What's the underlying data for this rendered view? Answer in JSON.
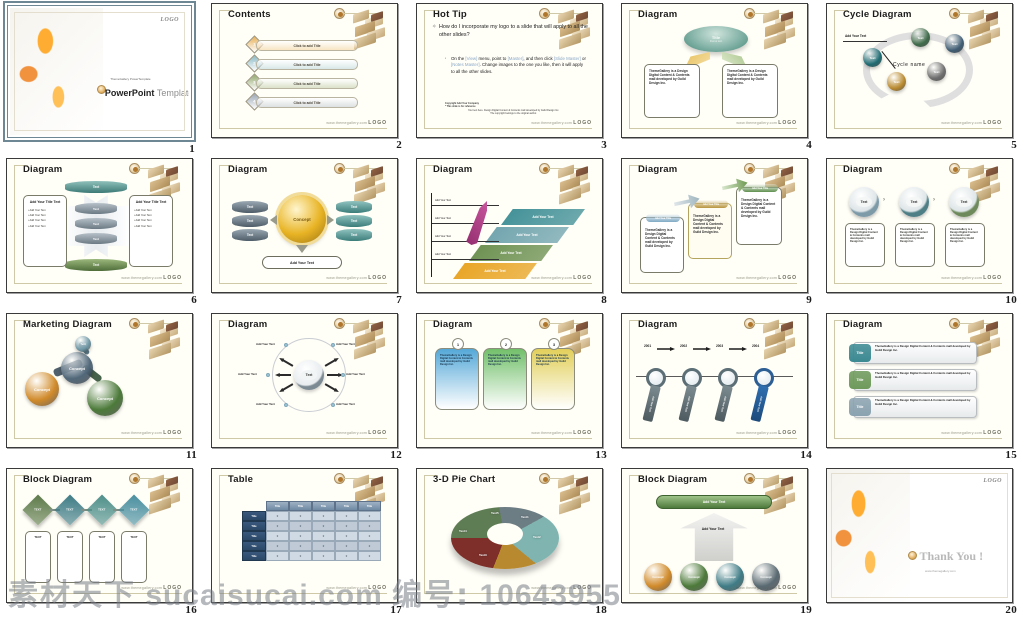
{
  "document": {
    "type": "powerpoint-template-preview-sheet",
    "slide_count": 20,
    "common": {
      "footer_url": "www.themegallery.com",
      "footer_brand": "LOGO",
      "logo_text": "LOGO",
      "theme_text": "ThemeGallery is a Design Digital Content & Contents mall developed by Guild Design Inc.",
      "add_your_text": "Add Your Text",
      "add_your_title_text": "Add Your Title Text",
      "text_label": "Text",
      "title_label": "Title",
      "concept_label": "Concept"
    }
  },
  "slides": [
    {
      "number": "1",
      "title": "",
      "kind": "cover",
      "logo": "LOGO",
      "subtitle": "ThemeGallery PowerTemplate",
      "main_bold": "PowerPoint",
      "main_light": "Template",
      "selected": true
    },
    {
      "number": "2",
      "title": "Contents",
      "kind": "contents",
      "items": [
        {
          "index": "1",
          "label": "Click to add Title",
          "color": "#e8b15a"
        },
        {
          "index": "2",
          "label": "Click to add Title",
          "color": "#8cb9c6"
        },
        {
          "index": "3",
          "label": "Click to add Title",
          "color": "#93a86d"
        },
        {
          "index": "4",
          "label": "Click to add Title",
          "color": "#9aa6b4"
        }
      ]
    },
    {
      "number": "3",
      "title": "Hot Tip",
      "kind": "hot-tip",
      "question": "How do I incorporate my logo to a slide that will apply to all the other slides?",
      "answer_parts": [
        {
          "text": "On the ",
          "highlight": false
        },
        {
          "text": "[View]",
          "highlight": true
        },
        {
          "text": " menu, point to ",
          "highlight": false
        },
        {
          "text": "[Master]",
          "highlight": true
        },
        {
          "text": ", and then click ",
          "highlight": false
        },
        {
          "text": "[Slide Master]",
          "highlight": true
        },
        {
          "text": " or ",
          "highlight": false
        },
        {
          "text": "[Notes Master]",
          "highlight": true
        },
        {
          "text": ". Change images to the one you like, then it will apply to all the other slides.",
          "highlight": false
        }
      ],
      "note_line1": "Copyright Add Your Company",
      "note_line2": "* This slide is for reference",
      "note_line3": "Your text here. Design Digital Content & Contents mall developed by Guild Design Inc.",
      "note_line4": "The copyright belongs to the original author."
    },
    {
      "number": "4",
      "title": "Diagram",
      "kind": "hub-two-box",
      "hub_title": "Title",
      "hub_sub": "theme text",
      "box_left": "ThemeGallery is a Design Digital Content & Contents mall developed by Guild Design Inc.",
      "box_right": "ThemeGallery is a Design Digital Content & Contents mall developed by Guild Design Inc."
    },
    {
      "number": "5",
      "title": "Cycle Diagram",
      "kind": "cycle",
      "callout": "Add Your Text",
      "center_label": "Cycle name",
      "nodes": [
        {
          "label": "Text",
          "color": "#3f6b4a"
        },
        {
          "label": "Text",
          "color": "#3f5d73"
        },
        {
          "label": "Text",
          "color": "#6d6d6d"
        },
        {
          "label": "Text",
          "color": "#b8892f"
        },
        {
          "label": "Text",
          "color": "#1e6b72"
        }
      ]
    },
    {
      "number": "6",
      "title": "Diagram",
      "kind": "stack-four",
      "top_label": "Text",
      "bottom_label": "Text",
      "middle_labels": [
        "Text",
        "Text",
        "Text"
      ],
      "side_title": "Add Your Title Text",
      "side_bullets": [
        "Add Your Text",
        "Add Your Text",
        "Add Your Text",
        "Add Your Text"
      ]
    },
    {
      "number": "7",
      "title": "Diagram",
      "kind": "concept-cylinders",
      "center_label": "Concept",
      "left_labels": [
        "Text",
        "Text",
        "Text"
      ],
      "right_labels": [
        "Text",
        "Text",
        "Text"
      ],
      "bottom_label": "Add Your Text"
    },
    {
      "number": "8",
      "title": "Diagram",
      "kind": "steps-up",
      "axis_labels": [
        "Add Your Text",
        "Add Your Text",
        "Add Your Text",
        "Add Your Text"
      ],
      "steps": [
        {
          "label": "Add Your Text",
          "color": "#e8a321"
        },
        {
          "label": "Add Your Text",
          "color": "#6a8f4e"
        },
        {
          "label": "Add Your Text",
          "color": "#6fa3ad"
        },
        {
          "label": "Add Your Text",
          "color": "#3f8f96"
        }
      ]
    },
    {
      "number": "9",
      "title": "Diagram",
      "kind": "three-cards-arrows",
      "cards": [
        {
          "badge": "Add Your Title",
          "body": "ThemeGallery is a Design Digital Content & Contents mall developed by Guild Design Inc.",
          "badge_color": "#7fa9c4"
        },
        {
          "badge": "Add Your Title",
          "body": "ThemeGallery is a Design Digital Content & Contents mall developed by Guild Design Inc.",
          "badge_color": "#b8953f"
        },
        {
          "badge": "Add Your Title",
          "body": "ThemeGallery is a Design Digital Content & Contents mall developed by Guild Design Inc.",
          "badge_color": "#5f8f4e"
        }
      ]
    },
    {
      "number": "10",
      "title": "Diagram",
      "kind": "three-rings",
      "rings": [
        {
          "label": "Text",
          "color": "#7d9aa8",
          "body": "ThemeGallery is a Design Digital Content & Contents mall developed by Guild Design Inc."
        },
        {
          "label": "Text",
          "color": "#4f7f86",
          "body": "ThemeGallery is a Design Digital Content & Contents mall developed by Guild Design Inc."
        },
        {
          "label": "Text",
          "color": "#6e8a5c",
          "body": "ThemeGallery is a Design Digital Content & Contents mall developed by Guild Design Inc."
        }
      ]
    },
    {
      "number": "11",
      "title": "Marketing Diagram",
      "kind": "marketing-spheres",
      "nodes": [
        {
          "label": "Concept",
          "color": "#d08a2a"
        },
        {
          "label": "Concept",
          "color": "#51687a"
        },
        {
          "label": "Concept",
          "color": "#4c7a3a"
        },
        {
          "label": "Text",
          "color": "#6f97a5"
        }
      ]
    },
    {
      "number": "12",
      "title": "Diagram",
      "kind": "radial-six",
      "center_label": "Text",
      "spokes": [
        "Add Your Text",
        "Add Your Text",
        "Add Your Text",
        "Add Your Text",
        "Add Your Text",
        "Add Your Text"
      ]
    },
    {
      "number": "13",
      "title": "Diagram",
      "kind": "three-numbered-cards",
      "cards": [
        {
          "number": "1",
          "body": "ThemeGallery is a Design Digital Content & Contents mall developed by Guild Design Inc.",
          "color": "#55a8d8"
        },
        {
          "number": "2",
          "body": "ThemeGallery is a Design Digital Content & Contents mall developed by Guild Design Inc.",
          "color": "#72bf6a"
        },
        {
          "number": "3",
          "body": "ThemeGallery is a Design Digital Content & Contents mall developed by Guild Design Inc.",
          "color": "#e2cf5a"
        }
      ]
    },
    {
      "number": "14",
      "title": "Diagram",
      "kind": "timeline-magnifiers",
      "years": [
        "2001",
        "2002",
        "2003",
        "2004"
      ],
      "handle_label": "Add Your Text"
    },
    {
      "number": "15",
      "title": "Diagram",
      "kind": "three-title-rows",
      "rows": [
        {
          "title": "Title",
          "body": "ThemeGallery is a Design Digital Content & Contents mall developed by Guild Design Inc.",
          "color": "#3d8a93"
        },
        {
          "title": "Title",
          "body": "ThemeGallery is a Design Digital Content & Contents mall developed by Guild Design Inc.",
          "color": "#6f9a5c"
        },
        {
          "title": "Title",
          "body": "ThemeGallery is a Design Digital Content & Contents mall developed by Guild Design Inc.",
          "color": "#8ba3b0"
        }
      ]
    },
    {
      "number": "16",
      "title": "Block Diagram",
      "kind": "block-cubes",
      "cubes": [
        {
          "label": "TEXT",
          "color": "#5d7a4a"
        },
        {
          "label": "TEXT",
          "color": "#3f7c86"
        },
        {
          "label": "TEXT",
          "color": "#4f8f8a"
        },
        {
          "label": "TEXT",
          "color": "#4a8fa0"
        }
      ],
      "boxes": [
        "TEXT",
        "TEXT",
        "TEXT",
        "TEXT"
      ]
    },
    {
      "number": "17",
      "title": "Table",
      "kind": "table",
      "column_headers": [
        "Title",
        "Title",
        "Title",
        "Title",
        "Title"
      ],
      "row_headers": [
        "Title",
        "Title",
        "Title",
        "Title",
        "Title"
      ],
      "cell_value": "0"
    },
    {
      "number": "18",
      "title": "3-D Pie Chart",
      "kind": "pie",
      "slices": [
        {
          "label": "Text1",
          "color": "#5f7d55",
          "value": 22
        },
        {
          "label": "Text2",
          "color": "#6d7d84",
          "value": 20
        },
        {
          "label": "Text3",
          "color": "#7fb4b0",
          "value": 19
        },
        {
          "label": "Text4",
          "color": "#b8892f",
          "value": 20
        },
        {
          "label": "Text5",
          "color": "#7e2f2a",
          "value": 19
        }
      ]
    },
    {
      "number": "19",
      "title": "Block Diagram",
      "kind": "pyramid-arrow",
      "top_bar": "Add Your Text",
      "arrow_label": "Add Your Text",
      "spheres": [
        {
          "label": "Concept",
          "color": "#d08a2a"
        },
        {
          "label": "Concept",
          "color": "#4c7a3a"
        },
        {
          "label": "Concept",
          "color": "#3f7c86"
        },
        {
          "label": "Concept",
          "color": "#5a6a72"
        }
      ]
    },
    {
      "number": "20",
      "title": "",
      "kind": "thank-you",
      "logo": "LOGO",
      "message": "Thank You !",
      "sub": "www.themegallery.com",
      "selected": false
    }
  ],
  "watermark": {
    "brand_cn": "素材天下",
    "site": "sucaisucai.com",
    "id_label": "编号:",
    "id_value": "10643955"
  }
}
